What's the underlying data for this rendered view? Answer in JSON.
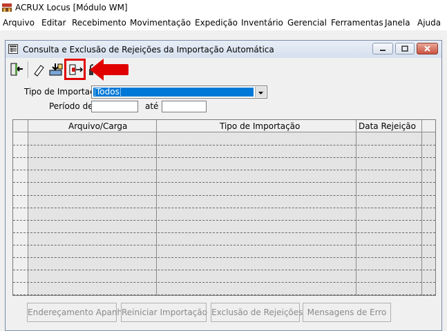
{
  "app": {
    "title": "ACRUX Locus [Módulo WM]"
  },
  "menu": [
    "Arquivo",
    "Editar",
    "Recebimento",
    "Movimentação",
    "Expedição",
    "Inventário",
    "Gerencial",
    "Ferramentas",
    "Janela",
    "Ajuda"
  ],
  "window": {
    "title": "Consulta e Exclusão de Rejeições da Importação Automática"
  },
  "toolbar": {
    "icons": [
      "exit-icon",
      "eraser-icon",
      "import-icon",
      "export-icon",
      "lock-icon"
    ]
  },
  "form": {
    "tipo_label": "Tipo de Importação",
    "tipo_value": "Todos",
    "periodo_label": "Período de",
    "ate_label": "até",
    "periodo_de": "",
    "periodo_ate": ""
  },
  "grid": {
    "columns": [
      "Arquivo/Carga",
      "Tipo de Importação",
      "Data Rejeição"
    ],
    "row_count": 13
  },
  "buttons": {
    "enderecamento": "Endereçamento Apanha",
    "reiniciar": "Reiniciar Importação",
    "exclusao": "Exclusão de Rejeições",
    "mensagens": "Mensagens de Erro"
  },
  "colors": {
    "selection": "#0078d7",
    "highlight": "#e00000"
  }
}
